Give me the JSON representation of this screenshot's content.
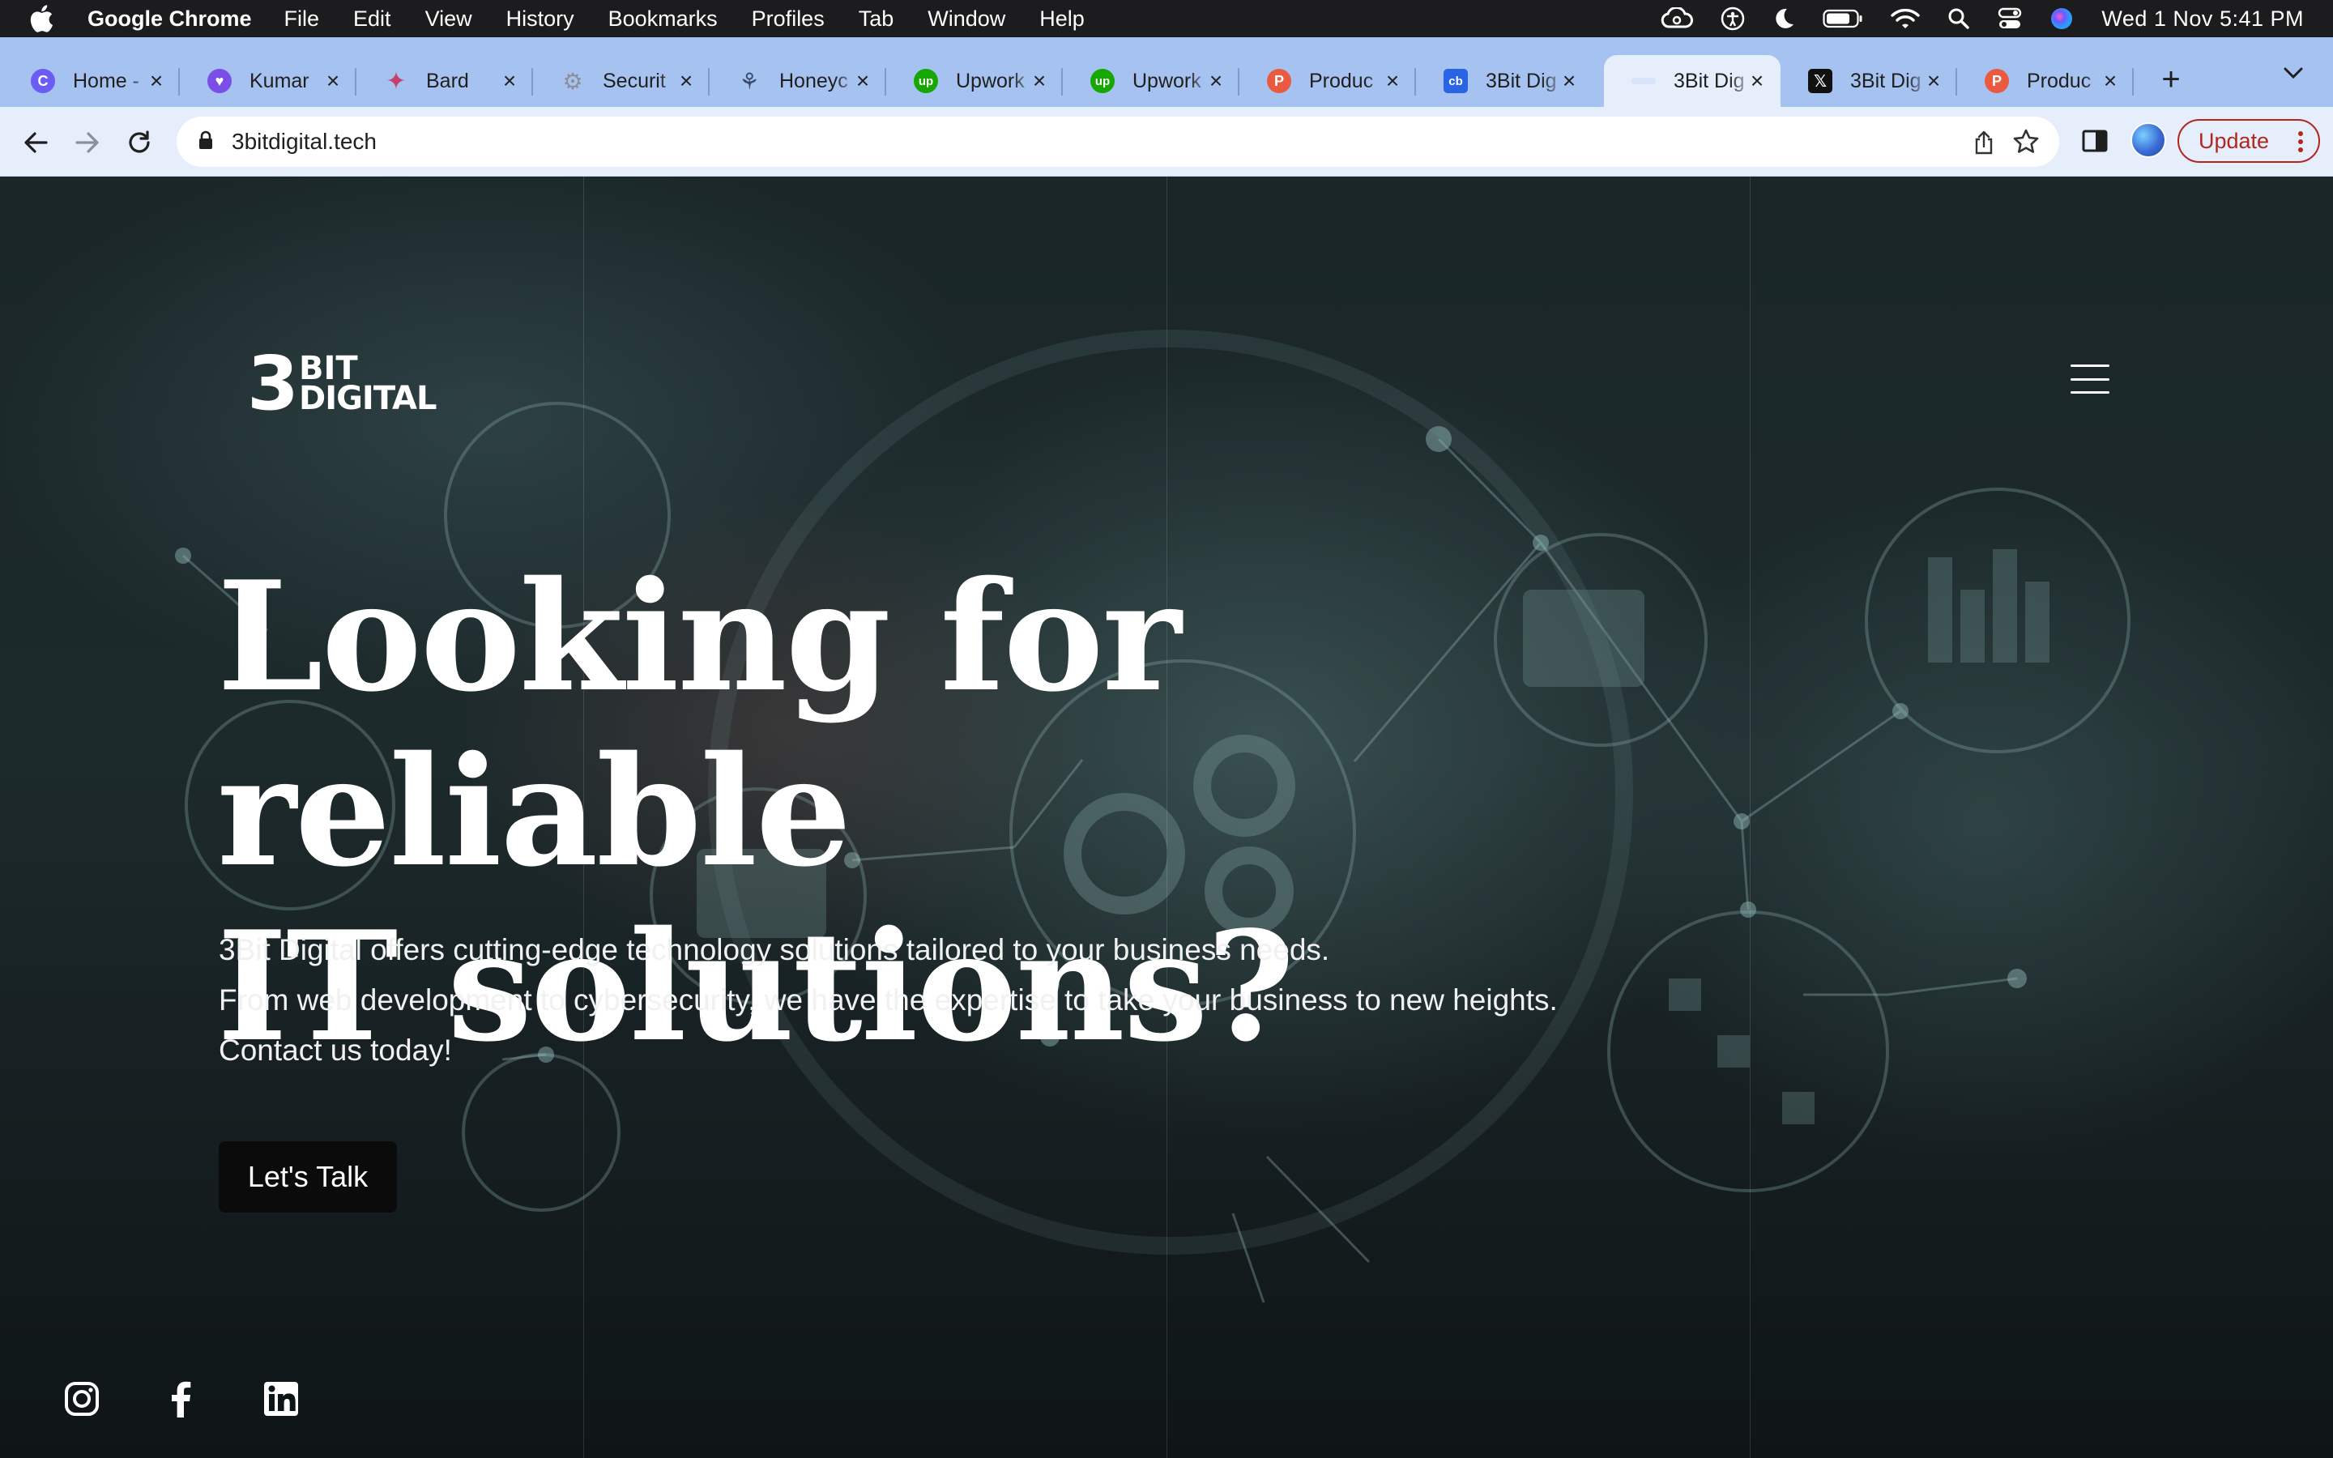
{
  "menubar": {
    "app_name": "Google Chrome",
    "items": [
      "File",
      "Edit",
      "View",
      "History",
      "Bookmarks",
      "Profiles",
      "Tab",
      "Window",
      "Help"
    ],
    "clock": "Wed 1 Nov  5:41 PM",
    "icons": [
      "creative-cloud-icon",
      "accessibility-icon",
      "moon-icon",
      "battery-icon",
      "wifi-icon",
      "search-icon",
      "control-center-icon",
      "siri-icon"
    ]
  },
  "tabs": [
    {
      "title": "Home -",
      "favicon": "C",
      "color": "#6a5cf5",
      "active": false
    },
    {
      "title": "Kumar",
      "favicon": "♥",
      "color": "#7b4ee8",
      "active": false
    },
    {
      "title": "Bard",
      "favicon": "✦",
      "color": "#c7406b",
      "active": false
    },
    {
      "title": "Securit",
      "favicon": "⚙",
      "color": "#8a8f9a",
      "active": false
    },
    {
      "title": "Honeyc",
      "favicon": "⚘",
      "color": "#3a4a6a",
      "active": false
    },
    {
      "title": "Upwork",
      "favicon": "up",
      "color": "#14a800",
      "active": false
    },
    {
      "title": "Upwork",
      "favicon": "up",
      "color": "#14a800",
      "active": false
    },
    {
      "title": "Produc",
      "favicon": "P",
      "color": "#ea5a40",
      "active": false
    },
    {
      "title": "3Bit Dig",
      "favicon": "cb",
      "color": "#2a64e6",
      "active": false
    },
    {
      "title": "3Bit Dig",
      "favicon": "",
      "color": "#d8e4fa",
      "active": true
    },
    {
      "title": "3Bit Dig",
      "favicon": "𝕏",
      "color": "#111111",
      "active": false
    },
    {
      "title": "Produc",
      "favicon": "P",
      "color": "#ea5a40",
      "active": false
    }
  ],
  "toolbar": {
    "url": "3bitdigital.tech",
    "update_label": "Update"
  },
  "site": {
    "logo_number": "3",
    "logo_line1": "BIT",
    "logo_line2": "DIGITAL",
    "headline_line1": "Looking for reliable",
    "headline_line2": "IT solutions?",
    "intro_line1": "3Bit Digital offers cutting-edge technology solutions tailored to your business needs.",
    "intro_line2": "From web development to cybersecurity, we have the expertise to take your business to new heights.",
    "intro_line3": "Contact us today!",
    "cta_label": "Let's Talk",
    "social": [
      "instagram-icon",
      "facebook-icon",
      "linkedin-icon"
    ]
  }
}
